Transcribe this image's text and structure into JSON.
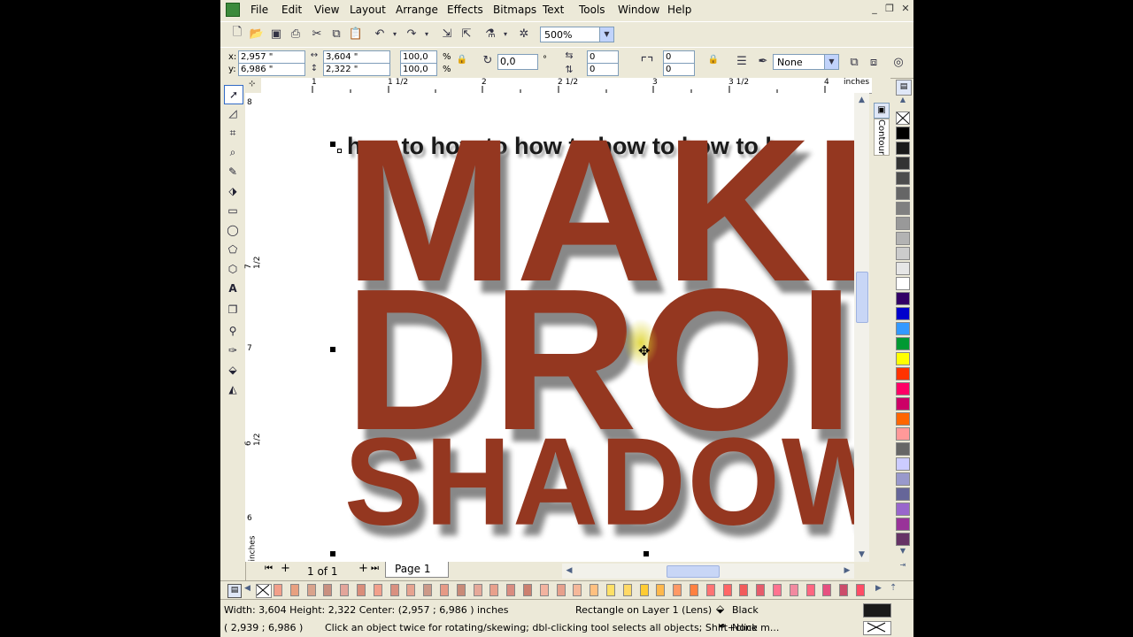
{
  "menu": [
    "File",
    "Edit",
    "View",
    "Layout",
    "Arrange",
    "Effects",
    "Bitmaps",
    "Text",
    "Tools",
    "Window",
    "Help"
  ],
  "zoom": "500%",
  "props": {
    "x_label": "x:",
    "x": "2,957 \"",
    "y_label": "y:",
    "y": "6,986 \"",
    "w": "3,604 \"",
    "h": "2,322 \"",
    "scale_x": "100,0",
    "scale_y": "100,0",
    "pct": "%",
    "angle": "0,0",
    "deg": "°",
    "corner_1": "0",
    "corner_2": "0",
    "corner_3": "0",
    "corner_4": "0",
    "outline": "None"
  },
  "ruler_h": [
    "1",
    "1 1/2",
    "2",
    "2 1/2",
    "3",
    "3 1/2",
    "4",
    "inches"
  ],
  "ruler_v": [
    "8",
    "7 1/2",
    "7",
    "6 1/2",
    "6",
    "inches"
  ],
  "canvas": {
    "line1": "how to how to how to how to how to ho",
    "line2": "MAKE",
    "line3": "DROI",
    "line4": "SHADOW",
    "text_color": "#943720",
    "small_text_color": "#1a1a1a"
  },
  "docker": {
    "tab": "Contour"
  },
  "pagenav": {
    "count": "1 of 1",
    "page_tab": "Page 1"
  },
  "palette": [
    "#000000",
    "#1a1a1a",
    "#333333",
    "#4d4d4d",
    "#666666",
    "#808080",
    "#999999",
    "#b3b3b3",
    "#cccccc",
    "#e6e6e6",
    "#ffffff",
    "#330066",
    "#0000cc",
    "#3399ff",
    "#009933",
    "#ffff00",
    "#ff3300",
    "#ff0066",
    "#cc0066",
    "#ff6600",
    "#ff9999",
    "#666666",
    "#ccccff",
    "#9999cc",
    "#666699",
    "#9966cc",
    "#993399",
    "#663366"
  ],
  "bottom_palette": [
    "#f29f8a",
    "#e8a080",
    "#d9a38c",
    "#c99080",
    "#e3a59a",
    "#d98d7a",
    "#f2a08c",
    "#d99080",
    "#e6a390",
    "#cc9988",
    "#e69a86",
    "#c88a78",
    "#e6a99a",
    "#e8a08c",
    "#d98c80",
    "#cc8070",
    "#f2b3a0",
    "#e6a08c",
    "#f5b89a",
    "#ffc080",
    "#ffe066",
    "#ffd966",
    "#ffcc33",
    "#ffb84d",
    "#ff9966",
    "#ff8040",
    "#ff7373",
    "#ff6666",
    "#f25c5c",
    "#e65c6b",
    "#ff7390",
    "#f28aa0",
    "#ff6680",
    "#e65080",
    "#cc4d6b",
    "#ff4d66"
  ],
  "status": {
    "line1": "Width: 3,604  Height: 2,322  Center: (2,957 ; 6,986 )  inches",
    "object": "Rectangle on Layer 1  (Lens)",
    "fill": "Black",
    "coords": "( 2,939 ; 6,986  )",
    "hint": "Click an object twice for rotating/skewing; dbl-clicking tool selects all objects; Shift+click m...",
    "outline": "None",
    "fill_swatch": "#1a1a1a"
  }
}
